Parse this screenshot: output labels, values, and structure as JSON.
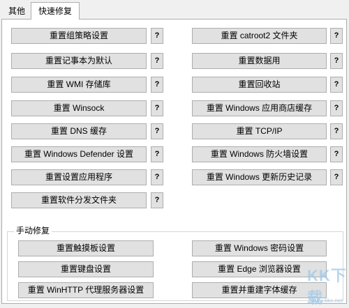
{
  "tabs": [
    "其他",
    "快速修复"
  ],
  "left_buttons": [
    "重置组策略设置",
    "重置记事本为默认",
    "重置 WMI 存储库",
    "重置 Winsock",
    "重置 DNS 缓存",
    "重置 Windows Defender 设置",
    "重置设置应用程序",
    "重置软件分发文件夹"
  ],
  "right_buttons": [
    "重置 catroot2 文件夹",
    "重置数据用",
    "重置回收站",
    "重置 Windows 应用商店缓存",
    "重置 TCP/IP",
    "重置 Windows 防火墙设置",
    "重置 Windows 更新历史记录"
  ],
  "help_label": "?",
  "manual_section": {
    "title": "手动修复",
    "left": [
      "重置触摸板设置",
      "重置键盘设置",
      "重置 WinHTTP 代理服务器设置"
    ],
    "right": [
      "重置 Windows 密码设置",
      "重置 Edge 浏览器设置",
      "重置并重建字体缓存"
    ]
  },
  "watermark": {
    "logo": "KK下载",
    "url": "www.kkx.net"
  }
}
